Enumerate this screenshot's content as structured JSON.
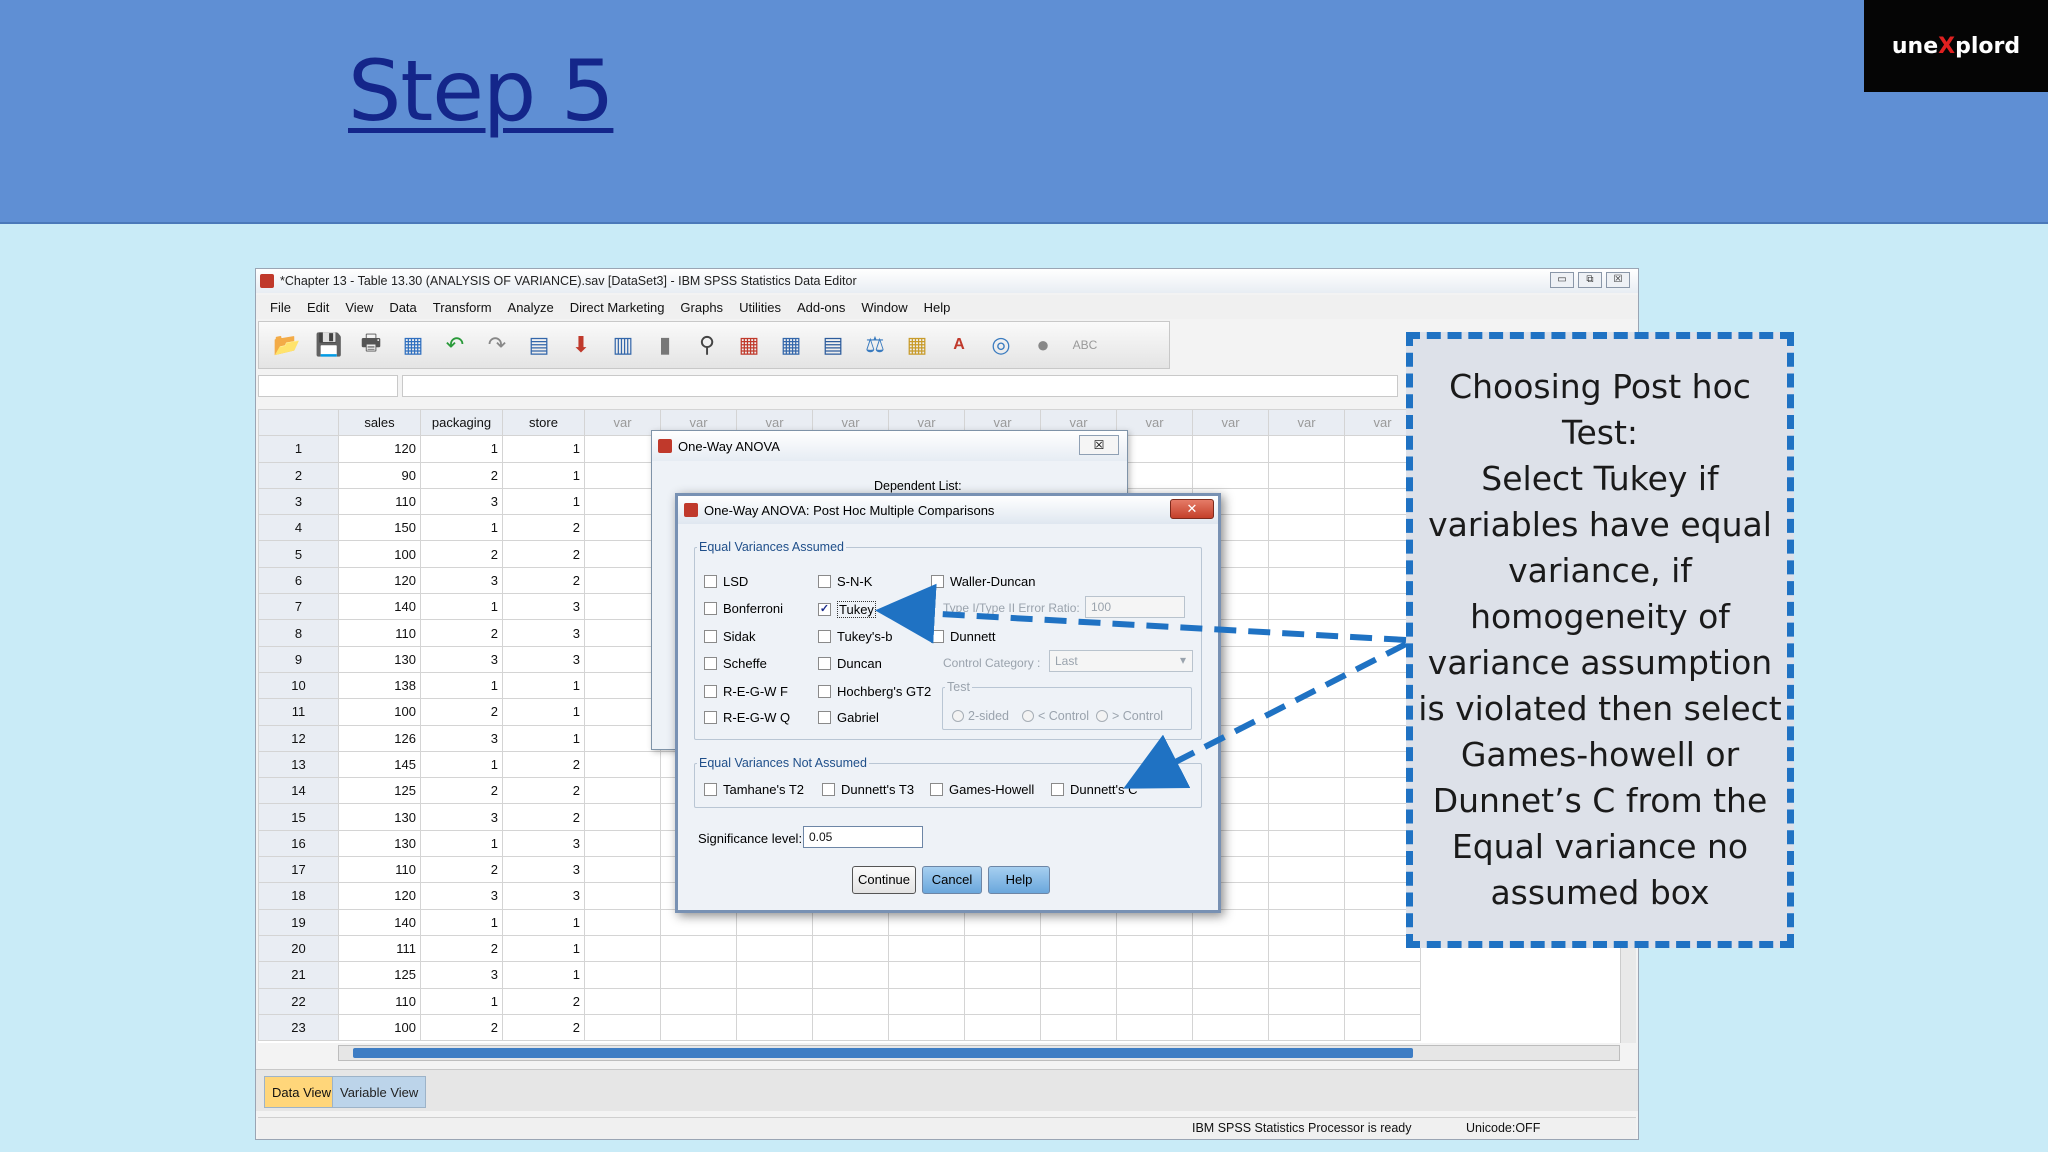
{
  "slide": {
    "title": "Step 5",
    "logo_pre": "une",
    "logo_x": "X",
    "logo_post": "plord"
  },
  "window": {
    "title": "*Chapter 13 - Table 13.30 (ANALYSIS OF VARIANCE).sav [DataSet3] - IBM SPSS Statistics Data Editor",
    "controls": {
      "minimize": "▭",
      "restore": "⧉",
      "close": "☒"
    }
  },
  "menu": [
    "File",
    "Edit",
    "View",
    "Data",
    "Transform",
    "Analyze",
    "Direct Marketing",
    "Graphs",
    "Utilities",
    "Add-ons",
    "Window",
    "Help"
  ],
  "toolbar": {
    "open": "📂",
    "save": "💾",
    "print": "🖶",
    "dialog_recall": "▦",
    "undo": "↶",
    "redo": "↷",
    "goto_case": "▤",
    "goto_var": "⬇",
    "variables": "▥",
    "run_desc": "▮",
    "find": "⚲",
    "insert_cases": "▦",
    "insert_var": "▦",
    "split": "▤",
    "weight": "⚖",
    "select": "▦",
    "value_labels": "A",
    "use_sets": "◎",
    "show_all": "●",
    "spell": "ABC"
  },
  "grid": {
    "columns": [
      "sales",
      "packaging",
      "store",
      "var",
      "var",
      "var",
      "var",
      "var",
      "var",
      "var",
      "var",
      "var",
      "var",
      "var"
    ],
    "rows": [
      [
        "1",
        "120",
        "1",
        "1"
      ],
      [
        "2",
        "90",
        "2",
        "1"
      ],
      [
        "3",
        "110",
        "3",
        "1"
      ],
      [
        "4",
        "150",
        "1",
        "2"
      ],
      [
        "5",
        "100",
        "2",
        "2"
      ],
      [
        "6",
        "120",
        "3",
        "2"
      ],
      [
        "7",
        "140",
        "1",
        "3"
      ],
      [
        "8",
        "110",
        "2",
        "3"
      ],
      [
        "9",
        "130",
        "3",
        "3"
      ],
      [
        "10",
        "138",
        "1",
        "1"
      ],
      [
        "11",
        "100",
        "2",
        "1"
      ],
      [
        "12",
        "126",
        "3",
        "1"
      ],
      [
        "13",
        "145",
        "1",
        "2"
      ],
      [
        "14",
        "125",
        "2",
        "2"
      ],
      [
        "15",
        "130",
        "3",
        "2"
      ],
      [
        "16",
        "130",
        "1",
        "3"
      ],
      [
        "17",
        "110",
        "2",
        "3"
      ],
      [
        "18",
        "120",
        "3",
        "3"
      ],
      [
        "19",
        "140",
        "1",
        "1"
      ],
      [
        "20",
        "111",
        "2",
        "1"
      ],
      [
        "21",
        "125",
        "3",
        "1"
      ],
      [
        "22",
        "110",
        "1",
        "2"
      ],
      [
        "23",
        "100",
        "2",
        "2"
      ]
    ]
  },
  "tabs": {
    "data_view": "Data View",
    "variable_view": "Variable View"
  },
  "status": {
    "processor": "IBM SPSS Statistics Processor is ready",
    "unicode": "Unicode:OFF"
  },
  "anova_dialog": {
    "title": "One-Way ANOVA",
    "close": "☒",
    "dependent_list": "Dependent List:"
  },
  "posthoc": {
    "title": "One-Way ANOVA: Post Hoc Multiple Comparisons",
    "close": "✕",
    "equal_assumed_legend": "Equal Variances Assumed",
    "col1": [
      "LSD",
      "Bonferroni",
      "Sidak",
      "Scheffe",
      "R-E-G-W F",
      "R-E-G-W Q"
    ],
    "col2": [
      "S-N-K",
      "Tukey",
      "Tukey's-b",
      "Duncan",
      "Hochberg's GT2",
      "Gabriel"
    ],
    "waller": "Waller-Duncan",
    "error_ratio_label": "Type I/Type II Error Ratio:",
    "error_ratio_value": "100",
    "dunnett": "Dunnett",
    "control_category_label": "Control Category :",
    "control_category_value": "Last",
    "test_legend": "Test",
    "test_options": [
      "2-sided",
      "< Control",
      "> Control"
    ],
    "not_assumed_legend": "Equal Variances Not Assumed",
    "not_assumed": [
      "Tamhane's T2",
      "Dunnett's T3",
      "Games-Howell",
      "Dunnett's C"
    ],
    "significance_label": "Significance level:",
    "significance_value": "0.05",
    "buttons": {
      "continue": "Continue",
      "cancel": "Cancel",
      "help": "Help"
    },
    "checked": [
      "Tukey"
    ]
  },
  "callout": {
    "text": "Choosing Post hoc\nTest:\nSelect Tukey if\nvariables have equal\nvariance, if\nhomogeneity of\nvariance assumption\nis violated then select\nGames-howell or\nDunnet’s C from the\nEqual variance no\nassumed box"
  },
  "colors": {
    "header": "#5f8fd4",
    "background": "#c9ebf7",
    "callout_border": "#1f72c3",
    "title": "#14268a"
  }
}
